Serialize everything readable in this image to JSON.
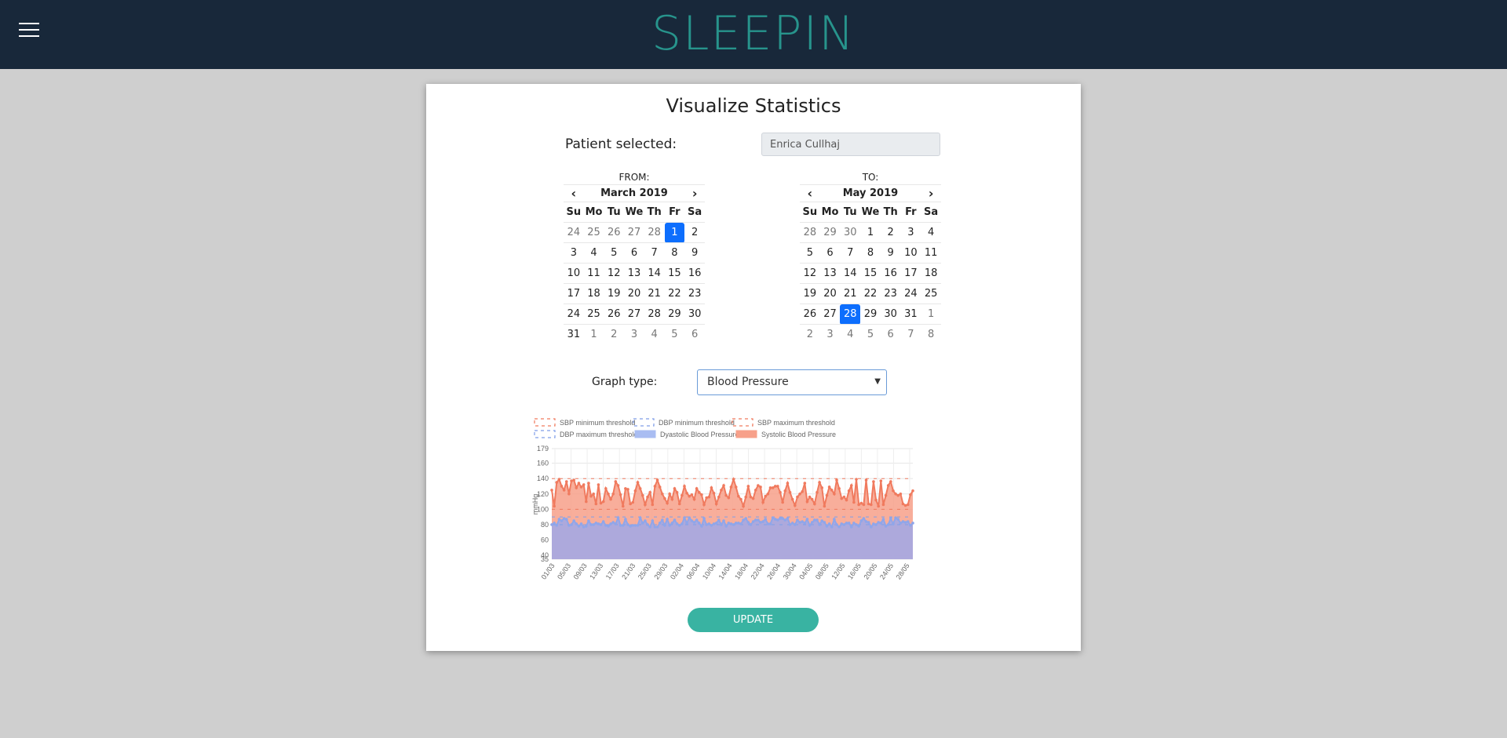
{
  "app": {
    "logo": "SLEEPIN"
  },
  "page": {
    "title": "Visualize Statistics"
  },
  "patient": {
    "label": "Patient selected:",
    "value": "Enrica Cullhaj"
  },
  "calendars": {
    "from": {
      "caption": "FROM:",
      "month": "March 2019",
      "dow": [
        "Su",
        "Mo",
        "Tu",
        "We",
        "Th",
        "Fr",
        "Sa"
      ],
      "weeks": [
        [
          "24",
          "25",
          "26",
          "27",
          "28",
          "1",
          "2"
        ],
        [
          "3",
          "4",
          "5",
          "6",
          "7",
          "8",
          "9"
        ],
        [
          "10",
          "11",
          "12",
          "13",
          "14",
          "15",
          "16"
        ],
        [
          "17",
          "18",
          "19",
          "20",
          "21",
          "22",
          "23"
        ],
        [
          "24",
          "25",
          "26",
          "27",
          "28",
          "29",
          "30"
        ],
        [
          "31",
          "1",
          "2",
          "3",
          "4",
          "5",
          "6"
        ]
      ],
      "muted": [
        [
          0,
          0
        ],
        [
          0,
          1
        ],
        [
          0,
          2
        ],
        [
          0,
          3
        ],
        [
          0,
          4
        ],
        [
          5,
          1
        ],
        [
          5,
          2
        ],
        [
          5,
          3
        ],
        [
          5,
          4
        ],
        [
          5,
          5
        ],
        [
          5,
          6
        ]
      ],
      "selected": [
        0,
        5
      ]
    },
    "to": {
      "caption": "TO:",
      "month": "May 2019",
      "dow": [
        "Su",
        "Mo",
        "Tu",
        "We",
        "Th",
        "Fr",
        "Sa"
      ],
      "weeks": [
        [
          "28",
          "29",
          "30",
          "1",
          "2",
          "3",
          "4"
        ],
        [
          "5",
          "6",
          "7",
          "8",
          "9",
          "10",
          "11"
        ],
        [
          "12",
          "13",
          "14",
          "15",
          "16",
          "17",
          "18"
        ],
        [
          "19",
          "20",
          "21",
          "22",
          "23",
          "24",
          "25"
        ],
        [
          "26",
          "27",
          "28",
          "29",
          "30",
          "31",
          "1"
        ],
        [
          "2",
          "3",
          "4",
          "5",
          "6",
          "7",
          "8"
        ]
      ],
      "muted": [
        [
          0,
          0
        ],
        [
          0,
          1
        ],
        [
          0,
          2
        ],
        [
          4,
          6
        ],
        [
          5,
          0
        ],
        [
          5,
          1
        ],
        [
          5,
          2
        ],
        [
          5,
          3
        ],
        [
          5,
          4
        ],
        [
          5,
          5
        ],
        [
          5,
          6
        ]
      ],
      "selected": [
        4,
        2
      ]
    }
  },
  "graph_type": {
    "label": "Graph type:",
    "value": "Blood Pressure"
  },
  "update_label": "UPDATE",
  "chart_data": {
    "type": "area",
    "ylabel": "mmHg",
    "ylim": [
      35,
      179
    ],
    "yticks": [
      35,
      40,
      60,
      80,
      100,
      120,
      140,
      160,
      179
    ],
    "xtick_labels": [
      "01/03",
      "05/03",
      "09/03",
      "13/03",
      "17/03",
      "21/03",
      "25/03",
      "29/03",
      "02/04",
      "06/04",
      "10/04",
      "14/04",
      "18/04",
      "22/04",
      "26/04",
      "30/04",
      "04/05",
      "08/05",
      "12/05",
      "16/05",
      "20/05",
      "24/05",
      "28/05"
    ],
    "legend": [
      {
        "label": "SBP minimum threshold",
        "style": "dashed",
        "color": "#f07a5e"
      },
      {
        "label": "DBP minimum threshold",
        "style": "dashed",
        "color": "#7f9ee8"
      },
      {
        "label": "SBP maximum threshold",
        "style": "dashed",
        "color": "#f07a5e"
      },
      {
        "label": "DBP maximum threshold",
        "style": "dashed",
        "color": "#7f9ee8"
      },
      {
        "label": "Dyastolic Blood Pressure",
        "style": "fill",
        "color": "#a9bdf2"
      },
      {
        "label": "Systolic Blood Pressure",
        "style": "fill",
        "color": "#f7a08a"
      }
    ],
    "thresholds": {
      "sbp_max": 140,
      "sbp_min": 100,
      "dbp_max": 90,
      "dbp_min": 80
    },
    "series": [
      {
        "name": "Systolic Blood Pressure",
        "color": "#f07a5e",
        "values": [
          125,
          104,
          135,
          139,
          130,
          125,
          136,
          120,
          137,
          138,
          128,
          134,
          129,
          132,
          110,
          134,
          117,
          120,
          107,
          132,
          108,
          110,
          127,
          120,
          113,
          120,
          136,
          131,
          119,
          104,
          127,
          126,
          107,
          109,
          124,
          135,
          127,
          118,
          106,
          116,
          122,
          106,
          130,
          138,
          129,
          120,
          114,
          108,
          120,
          113,
          127,
          122,
          107,
          118,
          130,
          121,
          117,
          119,
          113,
          127,
          122,
          119,
          106,
          115,
          116,
          128,
          121,
          107,
          116,
          125,
          131,
          118,
          115,
          129,
          139,
          129,
          117,
          113,
          104,
          116,
          130,
          116,
          114,
          125,
          131,
          129,
          109,
          117,
          120,
          128,
          128,
          130,
          130,
          122,
          109,
          124,
          134,
          122,
          113,
          105,
          116,
          120,
          123,
          134,
          110,
          116,
          113,
          107,
          122,
          135,
          128,
          104,
          118,
          129,
          125,
          120,
          138,
          127,
          114,
          116,
          112,
          124,
          131,
          109,
          139,
          106,
          108,
          106,
          138,
          107,
          106,
          136,
          112,
          104,
          137,
          106,
          118,
          131,
          136,
          124,
          120,
          118,
          120,
          107,
          105,
          106,
          119,
          124
        ]
      },
      {
        "name": "Dyastolic Blood Pressure",
        "color": "#8fa6ea",
        "values": [
          80,
          82,
          79,
          87,
          85,
          88,
          87,
          79,
          80,
          85,
          81,
          78,
          81,
          77,
          78,
          85,
          80,
          80,
          82,
          81,
          80,
          84,
          79,
          78,
          81,
          83,
          81,
          89,
          79,
          79,
          87,
          80,
          78,
          79,
          79,
          79,
          89,
          82,
          85,
          80,
          77,
          85,
          77,
          77,
          82,
          86,
          79,
          87,
          79,
          82,
          86,
          81,
          79,
          81,
          89,
          82,
          89,
          85,
          83,
          86,
          82,
          78,
          88,
          80,
          81,
          79,
          81,
          82,
          86,
          80,
          85,
          78,
          82,
          81,
          80,
          82,
          82,
          81,
          86,
          88,
          83,
          80,
          84,
          86,
          86,
          83,
          84,
          87,
          81,
          81,
          89,
          87,
          86,
          88,
          88,
          86,
          88,
          80,
          82,
          80,
          86,
          83,
          84,
          82,
          87,
          79,
          83,
          86,
          86,
          80,
          85,
          83,
          78,
          81,
          77,
          87,
          80,
          77,
          81,
          80,
          82,
          82,
          77,
          82,
          80,
          78,
          85,
          88,
          84,
          83,
          77,
          81,
          80,
          83,
          82,
          87,
          78,
          80,
          88,
          81,
          89,
          87,
          82,
          84,
          83,
          84,
          79,
          82
        ]
      }
    ]
  }
}
